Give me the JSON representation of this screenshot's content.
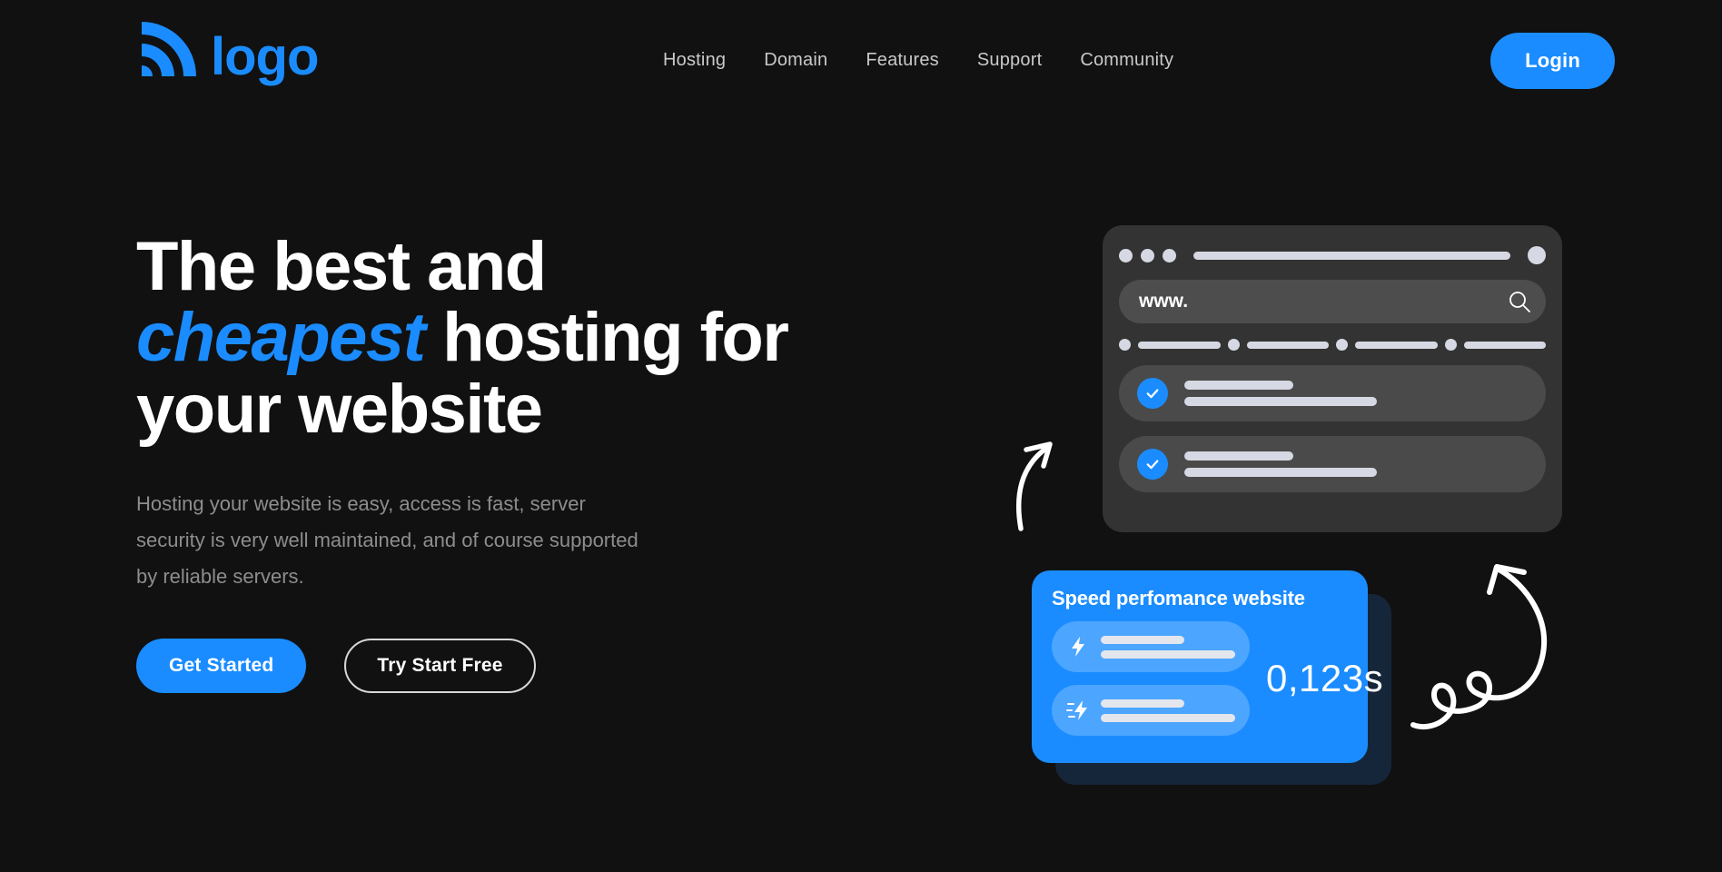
{
  "brand": {
    "name": "logo",
    "mark_icon": "signal-arcs-icon",
    "color": "#1a8cff"
  },
  "nav": {
    "items": [
      {
        "label": "Hosting"
      },
      {
        "label": "Domain"
      },
      {
        "label": "Features"
      },
      {
        "label": "Support"
      },
      {
        "label": "Community"
      }
    ]
  },
  "header": {
    "login_label": "Login"
  },
  "hero": {
    "headline_part1": "The best and",
    "headline_accent": "cheapest",
    "headline_part2": " hosting for",
    "headline_part3": "your website",
    "paragraph": "Hosting your website is easy, access is fast, server security is very well maintained, and of course supported by reliable servers.",
    "primary_cta": "Get Started",
    "secondary_cta": "Try Start Free"
  },
  "browser_mock": {
    "search_value": "www.",
    "search_icon": "magnifier-icon",
    "window_dots": 3,
    "bookmark_count": 4,
    "check_rows": [
      {
        "icon": "check-circle-icon"
      },
      {
        "icon": "check-circle-icon"
      }
    ]
  },
  "speed_card": {
    "title": "Speed perfomance website",
    "value": "0,123s",
    "rows": [
      {
        "icon": "bolt-icon"
      },
      {
        "icon": "bolt-lines-icon"
      }
    ],
    "color": "#1a8cff",
    "shadow_color": "#16263a"
  },
  "decorations": {
    "arrow_up_icon": "curved-arrow-up-right-icon",
    "arrow_curl_icon": "curly-arrow-up-left-icon"
  },
  "theme": {
    "background": "#111111",
    "accent": "#1a8cff",
    "text_primary": "#ffffff",
    "text_muted": "#8d8d8d",
    "card_bg": "#333333"
  }
}
